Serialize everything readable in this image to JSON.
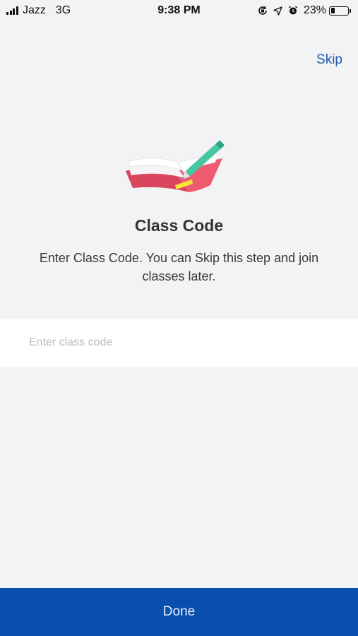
{
  "status_bar": {
    "carrier": "Jazz",
    "network": "3G",
    "time": "9:38 PM",
    "battery_percent": "23%",
    "battery_level": 0.23,
    "icons": [
      "signal-icon",
      "screen-lock-icon",
      "location-arrow-icon",
      "alarm-clock-icon",
      "battery-icon"
    ]
  },
  "header": {
    "skip_label": "Skip"
  },
  "main": {
    "illustration_icon": "open-book-pencil-icon",
    "title": "Class Code",
    "subtitle": "Enter Class Code. You can Skip this step and join classes later.",
    "input": {
      "placeholder": "Enter class code",
      "value": ""
    }
  },
  "footer": {
    "done_label": "Done"
  },
  "colors": {
    "background": "#f2f3f5",
    "accent": "#0a4fad",
    "link": "#1f5ba8",
    "book": "#ee5a6f",
    "pencil": "#49c7a3",
    "highlight": "#f5e33a"
  }
}
